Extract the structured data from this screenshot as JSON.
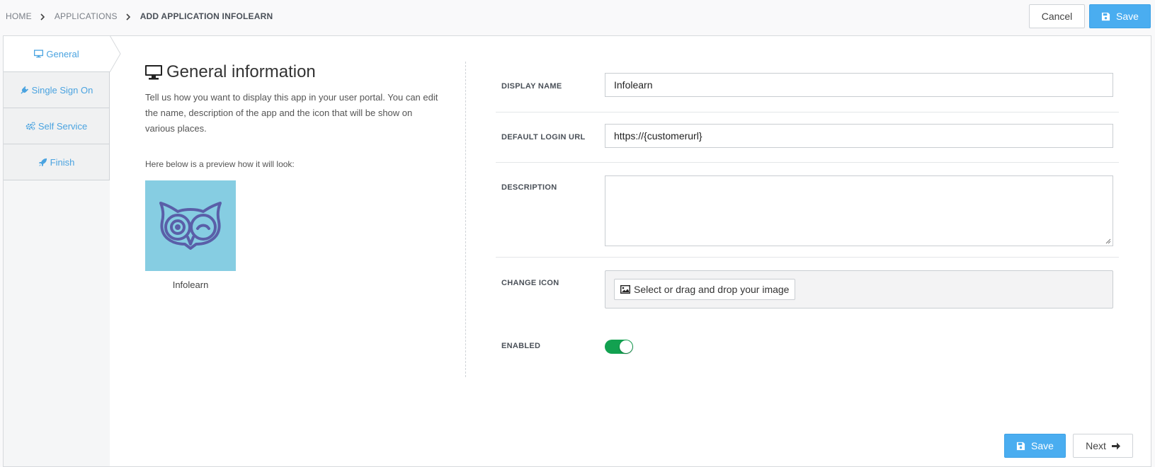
{
  "breadcrumb": {
    "home": "HOME",
    "applications": "APPLICATIONS",
    "current": "ADD APPLICATION INFOLEARN"
  },
  "header": {
    "cancel_label": "Cancel",
    "save_label": "Save"
  },
  "sidebar": {
    "items": [
      {
        "label": "General",
        "icon": "monitor-icon",
        "active": true
      },
      {
        "label": "Single Sign On",
        "icon": "plug-icon",
        "active": false
      },
      {
        "label": "Self Service",
        "icon": "cogs-icon",
        "active": false
      },
      {
        "label": "Finish",
        "icon": "rocket-icon",
        "active": false
      }
    ]
  },
  "general": {
    "title": "General information",
    "intro": "Tell us how you want to display this app in your user portal. You can edit the name, description of the app and the icon that will be show on various places.",
    "preview_label": "Here below is a preview how it will look:",
    "app_name": "Infolearn"
  },
  "form": {
    "display_name_label": "DISPLAY NAME",
    "display_name_value": "Infolearn",
    "login_url_label": "DEFAULT LOGIN URL",
    "login_url_value": "https://{customerurl}",
    "description_label": "DESCRIPTION",
    "description_value": "",
    "change_icon_label": "CHANGE ICON",
    "select_image_label": "Select or drag and drop your image",
    "enabled_label": "ENABLED",
    "enabled": true
  },
  "footer": {
    "save_label": "Save",
    "next_label": "Next"
  },
  "colors": {
    "primary": "#4aadf0",
    "toggle_on": "#12a150",
    "tile_bg": "#86cde2",
    "owl": "#5a5fa8"
  }
}
